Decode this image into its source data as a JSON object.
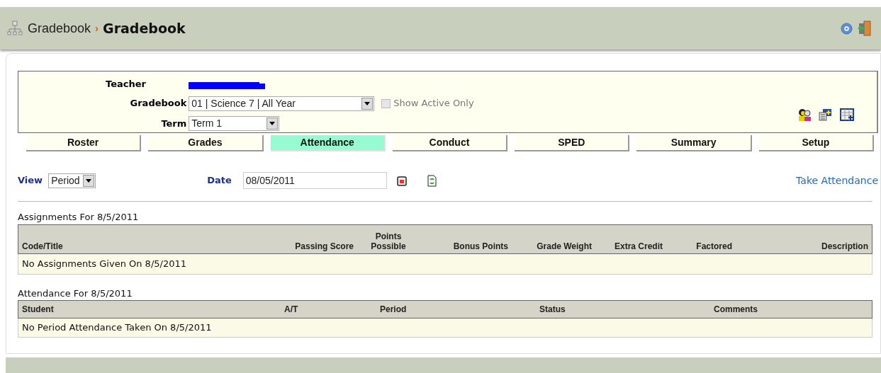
{
  "breadcrumb": {
    "parent": "Gradebook",
    "separator": "›",
    "current": "Gradebook"
  },
  "filters": {
    "teacher_label": "Teacher",
    "gradebook_label": "Gradebook",
    "gradebook_value": "01 | Science 7 | All Year",
    "show_active_only": {
      "label": "Show Active Only",
      "checked": false,
      "disabled": true
    },
    "term_label": "Term",
    "term_value": "Term 1"
  },
  "tabs": [
    {
      "label": "Roster",
      "selected": false
    },
    {
      "label": "Grades",
      "selected": false
    },
    {
      "label": "Attendance",
      "selected": true
    },
    {
      "label": "Conduct",
      "selected": false
    },
    {
      "label": "SPED",
      "selected": false
    },
    {
      "label": "Summary",
      "selected": false
    },
    {
      "label": "Setup",
      "selected": false
    }
  ],
  "toolbar": {
    "view_label": "View",
    "view_value": "Period",
    "date_label": "Date",
    "date_value": "08/05/2011",
    "take_attendance": "Take Attendance"
  },
  "assignments": {
    "title": "Assignments For 8/5/2011",
    "columns": [
      "Code/Title",
      "Passing Score",
      "Points Possible",
      "Bonus Points",
      "Grade Weight",
      "Extra Credit",
      "Factored",
      "Description"
    ],
    "empty_message": "No Assignments Given On 8/5/2011"
  },
  "attendance": {
    "title": "Attendance For 8/5/2011",
    "columns": [
      "Student",
      "A/T",
      "Period",
      "Status",
      "Comments"
    ],
    "empty_message": "No Period Attendance Taken On 8/5/2011"
  }
}
